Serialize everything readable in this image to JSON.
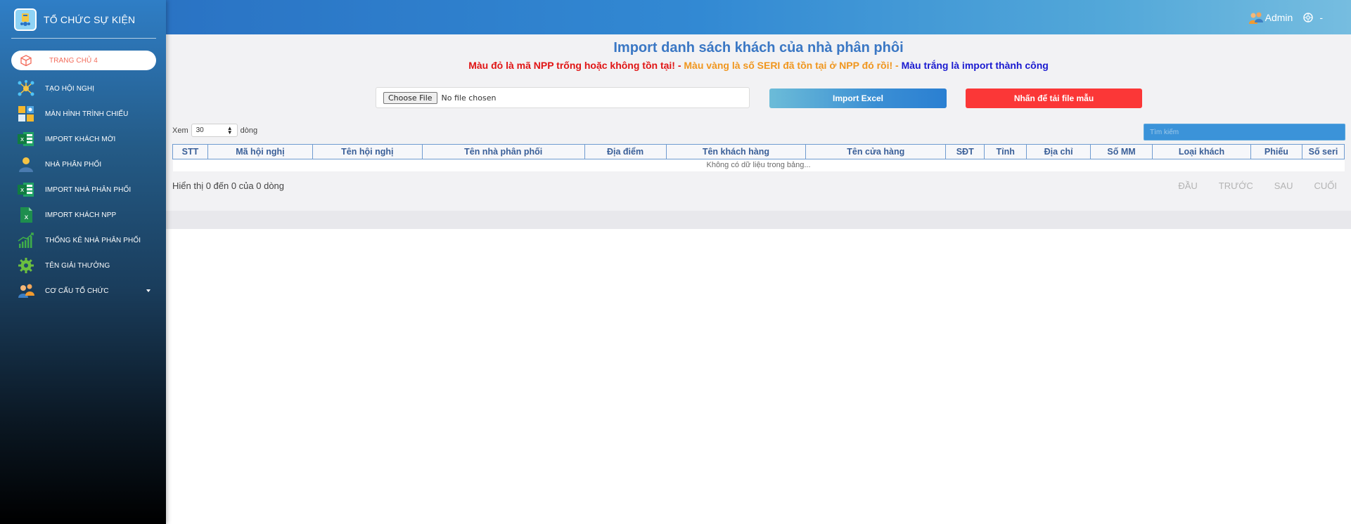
{
  "app": {
    "title": "TỔ CHỨC SỰ KIỆN"
  },
  "sidebar": {
    "items": [
      {
        "label": "TRANG CHỦ 4",
        "icon": "cube-icon",
        "active": true
      },
      {
        "label": "TẠO HỘI NGHỊ",
        "icon": "network-icon"
      },
      {
        "label": "MÀN HÌNH TRÌNH CHIẾU",
        "icon": "screen-grid-icon"
      },
      {
        "label": "IMPORT KHÁCH MỜI",
        "icon": "excel-icon"
      },
      {
        "label": "NHÀ PHÂN PHỐI",
        "icon": "person-icon"
      },
      {
        "label": "IMPORT NHÀ PHÂN PHỐI",
        "icon": "excel-icon"
      },
      {
        "label": "IMPORT KHÁCH NPP",
        "icon": "excel-file-icon"
      },
      {
        "label": "THỐNG KÊ NHÀ PHÂN PHỐI",
        "icon": "growth-chart-icon"
      },
      {
        "label": "TÊN GIẢI THƯỞNG",
        "icon": "gear-icon"
      },
      {
        "label": "CƠ CẤU TỔ CHỨC",
        "icon": "people-icon",
        "has_caret": true
      }
    ]
  },
  "header": {
    "user_name": "Admin",
    "trailing": "-"
  },
  "main": {
    "title": "Import danh sách khách của nhà phân phôi",
    "legend_red": "Màu đỏ là mã NPP trống hoặc không tồn tại! -",
    "legend_orange": "Màu vàng là số SERI đã tồn tại ở NPP đó rồi! -",
    "legend_blue": "Màu trắng là import thành công",
    "file_button": "Choose File",
    "file_status": "No file chosen",
    "import_button": "Import Excel",
    "sample_button": "Nhấn để tải file mẫu",
    "show_prefix": "Xem",
    "show_value": "30",
    "show_suffix": "dòng",
    "search_placeholder": "Tìm kiếm",
    "columns": [
      "STT",
      "Mã hội nghị",
      "Tên hội nghị",
      "Tên nhà phân phối",
      "Địa điểm",
      "Tên khách hàng",
      "Tên cửa hàng",
      "SĐT",
      "Tỉnh",
      "Địa chỉ",
      "Số MM",
      "Loại khách",
      "Phiếu",
      "Số seri"
    ],
    "empty_text": "Không có dữ liệu trong bảng...",
    "info_text": "Hiển thị 0 đến 0 của 0 dòng",
    "pager": {
      "first": "ĐẦU",
      "prev": "TRƯỚC",
      "next": "SAU",
      "last": "CUỐI"
    }
  },
  "colors": {
    "accent": "#3a77c4",
    "danger": "#fb3737",
    "warning": "#f0961e",
    "success_text": "#1a1ad0"
  }
}
